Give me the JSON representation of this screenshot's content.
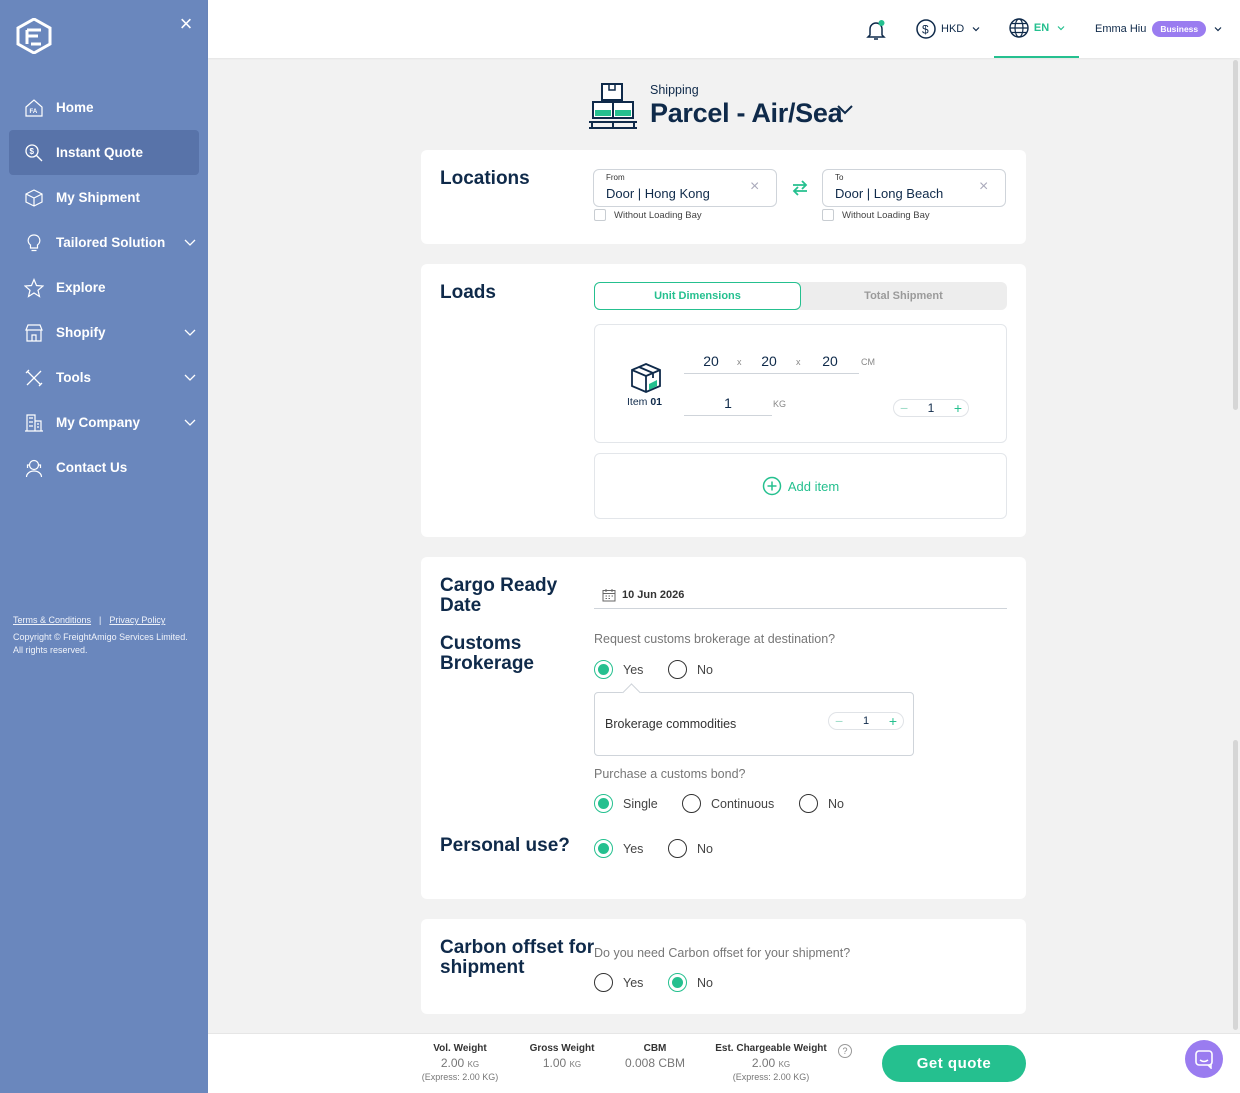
{
  "sidebar": {
    "items": [
      {
        "label": "Home",
        "icon": "home-icon"
      },
      {
        "label": "Instant Quote",
        "icon": "quote-icon",
        "active": true
      },
      {
        "label": "My Shipment",
        "icon": "box-icon"
      },
      {
        "label": "Tailored Solution",
        "icon": "bulb-icon",
        "expandable": true
      },
      {
        "label": "Explore",
        "icon": "star-icon"
      },
      {
        "label": "Shopify",
        "icon": "store-icon",
        "expandable": true
      },
      {
        "label": "Tools",
        "icon": "tools-icon",
        "expandable": true
      },
      {
        "label": "My Company",
        "icon": "building-icon",
        "expandable": true
      },
      {
        "label": "Contact Us",
        "icon": "support-icon"
      }
    ],
    "footer": {
      "terms": "Terms & Conditions",
      "separator": "|",
      "privacy": "Privacy Policy",
      "copyright": "Copyright © FreightAmigo Services Limited. All rights reserved."
    }
  },
  "header": {
    "currency": "HKD",
    "language": "EN",
    "user_name": "Emma Hiu",
    "user_badge": "Business"
  },
  "mode": {
    "subtitle": "Shipping",
    "title": "Parcel - Air/Sea"
  },
  "locations": {
    "title": "Locations",
    "from_label": "From",
    "from_value": "Door | Hong Kong",
    "to_label": "To",
    "to_value": "Door | Long Beach",
    "from_loading_bay": "Without Loading Bay",
    "to_loading_bay": "Without Loading Bay"
  },
  "loads": {
    "title": "Loads",
    "tab_unit": "Unit Dimensions",
    "tab_total": "Total Shipment",
    "item": {
      "label_prefix": "Item",
      "label_num": "01",
      "length": "20",
      "width": "20",
      "height": "20",
      "x_sep": "x",
      "dim_unit": "CM",
      "weight": "1",
      "weight_unit": "KG",
      "quantity": "1"
    },
    "add_item": "Add item"
  },
  "details": {
    "cargo_title": "Cargo Ready Date",
    "cargo_date": "10 Jun 2026",
    "customs_title": "Customs Brokerage",
    "customs_question": "Request customs brokerage at destination?",
    "customs_yes": "Yes",
    "customs_no": "No",
    "customs_selected": "Yes",
    "brokerage_label": "Brokerage commodities",
    "brokerage_count": "1",
    "bond_question": "Purchase a customs bond?",
    "bond_single": "Single",
    "bond_continuous": "Continuous",
    "bond_no": "No",
    "bond_selected": "Single",
    "personal_title": "Personal use?",
    "personal_yes": "Yes",
    "personal_no": "No",
    "personal_selected": "Yes"
  },
  "carbon": {
    "title": "Carbon offset for shipment",
    "question": "Do you need Carbon offset for your shipment?",
    "yes": "Yes",
    "no": "No",
    "selected": "No"
  },
  "summary": {
    "vol_label": "Vol. Weight",
    "vol_value": "2.00",
    "vol_unit": "KG",
    "vol_express": "(Express: 2.00 KG)",
    "gross_label": "Gross Weight",
    "gross_value": "1.00",
    "gross_unit": "KG",
    "cbm_label": "CBM",
    "cbm_value": "0.008 CBM",
    "charge_label": "Est. Chargeable Weight",
    "charge_value": "2.00",
    "charge_unit": "KG",
    "charge_express": "(Express: 2.00 KG)",
    "help": "?",
    "get_quote": "Get quote"
  },
  "colors": {
    "sidebar": "#6a87bd",
    "accent": "#25c08f",
    "navy": "#0f2a4a",
    "badge": "#9a7cf0"
  }
}
